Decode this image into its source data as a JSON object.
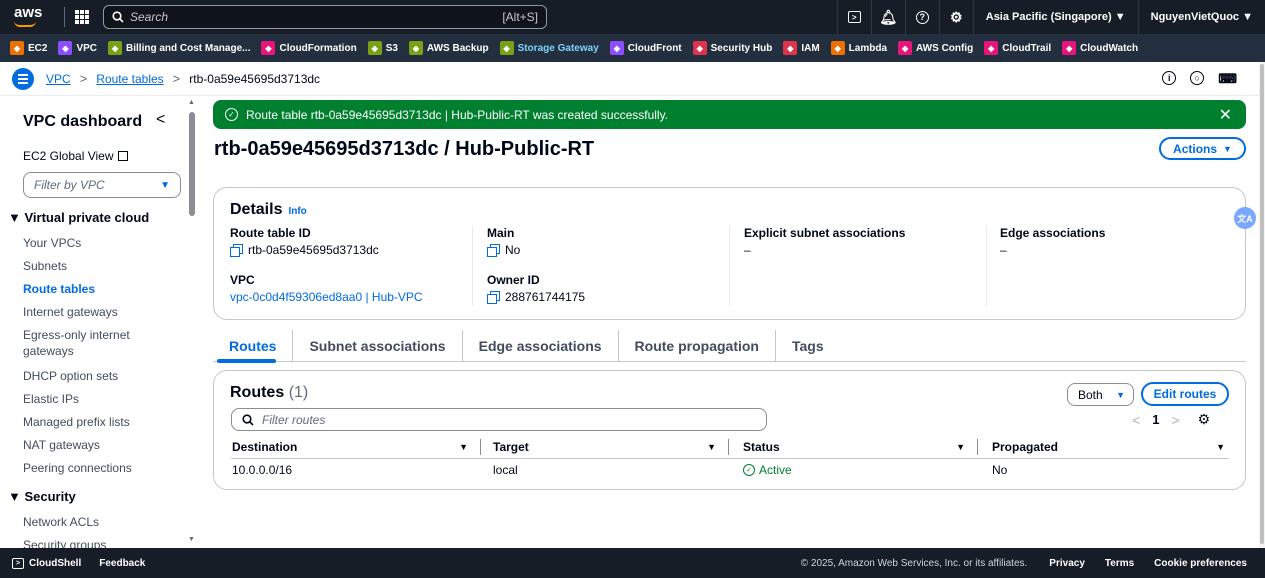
{
  "topnav": {
    "logo": "aws",
    "search_placeholder": "Search",
    "search_hint": "[Alt+S]",
    "region": "Asia Pacific (Singapore) ▼",
    "account": "NguyenVietQuoc ▼"
  },
  "favorites": [
    {
      "label": "EC2",
      "color": "#ed7100"
    },
    {
      "label": "VPC",
      "color": "#8c4fff"
    },
    {
      "label": "Billing and Cost Manage...",
      "color": "#7aa116"
    },
    {
      "label": "CloudFormation",
      "color": "#e7157b"
    },
    {
      "label": "S3",
      "color": "#7aa116"
    },
    {
      "label": "AWS Backup",
      "color": "#7aa116"
    },
    {
      "label": "Storage Gateway",
      "color": "#7aa116",
      "highlight": "#7dd3fc"
    },
    {
      "label": "CloudFront",
      "color": "#8c4fff"
    },
    {
      "label": "Security Hub",
      "color": "#dd344c"
    },
    {
      "label": "IAM",
      "color": "#dd344c"
    },
    {
      "label": "Lambda",
      "color": "#ed7100"
    },
    {
      "label": "AWS Config",
      "color": "#e7157b"
    },
    {
      "label": "CloudTrail",
      "color": "#e7157b"
    },
    {
      "label": "CloudWatch",
      "color": "#e7157b"
    }
  ],
  "breadcrumb": {
    "vpc": "VPC",
    "route_tables": "Route tables",
    "current": "rtb-0a59e45695d3713dc"
  },
  "sidebar": {
    "title": "VPC dashboard",
    "ec2_global_view": "EC2 Global View",
    "filter_placeholder": "Filter by VPC",
    "section_vpc": "Virtual private cloud",
    "items": [
      {
        "label": "Your VPCs"
      },
      {
        "label": "Subnets"
      },
      {
        "label": "Route tables",
        "active": true
      },
      {
        "label": "Internet gateways"
      },
      {
        "label": "Egress-only internet gateways"
      },
      {
        "label": "DHCP option sets"
      },
      {
        "label": "Elastic IPs"
      },
      {
        "label": "Managed prefix lists"
      },
      {
        "label": "NAT gateways"
      },
      {
        "label": "Peering connections"
      }
    ],
    "section_security": "Security",
    "security_items": [
      {
        "label": "Network ACLs"
      },
      {
        "label": "Security groups"
      }
    ]
  },
  "flash": {
    "message": "Route table rtb-0a59e45695d3713dc | Hub-Public-RT was created successfully.",
    "color": "#00802f"
  },
  "page_title": "rtb-0a59e45695d3713dc / Hub-Public-RT",
  "actions_label": "Actions",
  "details": {
    "title": "Details",
    "info": "Info",
    "route_table_id_label": "Route table ID",
    "route_table_id": "rtb-0a59e45695d3713dc",
    "main_label": "Main",
    "main": "No",
    "explicit_label": "Explicit subnet associations",
    "explicit": "–",
    "edge_label": "Edge associations",
    "edge": "–",
    "vpc_label": "VPC",
    "vpc": "vpc-0c0d4f59306ed8aa0 | Hub-VPC",
    "owner_label": "Owner ID",
    "owner": "288761744175"
  },
  "tabs": [
    "Routes",
    "Subnet associations",
    "Edge associations",
    "Route propagation",
    "Tags"
  ],
  "routes": {
    "title": "Routes",
    "count": "(1)",
    "both_label": "Both",
    "edit_label": "Edit routes",
    "filter_placeholder": "Filter routes",
    "page": "1",
    "columns": [
      "Destination",
      "Target",
      "Status",
      "Propagated"
    ],
    "rows": [
      {
        "destination": "10.0.0.0/16",
        "target": "local",
        "status": "Active",
        "propagated": "No"
      }
    ]
  },
  "translate_badge": "文A",
  "footer": {
    "cloudshell": "CloudShell",
    "feedback": "Feedback",
    "copyright": "© 2025, Amazon Web Services, Inc. or its affiliates.",
    "links": [
      "Privacy",
      "Terms",
      "Cookie preferences"
    ]
  }
}
